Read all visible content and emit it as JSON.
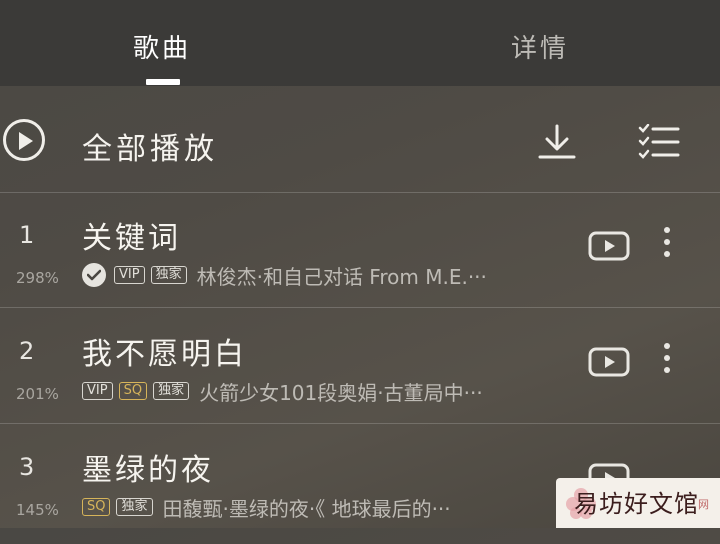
{
  "tabs": {
    "songs": "歌曲",
    "details": "详情"
  },
  "play_all": {
    "label": "全部播放"
  },
  "songs": [
    {
      "rank": "1",
      "title": "关键词",
      "percent": "298%",
      "verified": true,
      "tags": [
        "VIP",
        "独家"
      ],
      "artist": "林俊杰·和自己对话 From M.E.···"
    },
    {
      "rank": "2",
      "title": "我不愿明白",
      "percent": "201%",
      "verified": false,
      "tags": [
        "VIP",
        "SQ",
        "独家"
      ],
      "artist": "火箭少女101段奥娟·古董局中···"
    },
    {
      "rank": "3",
      "title": "墨绿的夜",
      "percent": "145%",
      "verified": false,
      "tags": [
        "SQ",
        "独家"
      ],
      "artist": "田馥甄·墨绿的夜·《 地球最后的···"
    }
  ],
  "watermark": {
    "text": "易坊好文馆",
    "small": "网"
  },
  "colors": {
    "topbar": "#3b3a38",
    "sq_tag": "#d6b45a",
    "background": "#4f4b45"
  }
}
